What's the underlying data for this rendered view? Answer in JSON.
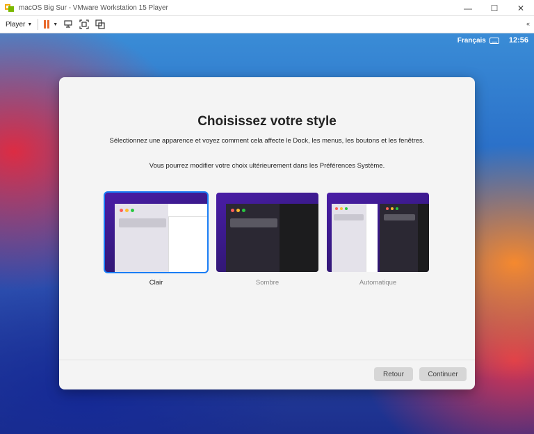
{
  "window": {
    "title": "macOS Big Sur - VMware Workstation 15 Player",
    "minimize": "—",
    "maximize": "☐",
    "close": "✕"
  },
  "toolbar": {
    "player_label": "Player",
    "collapse": "«"
  },
  "menubar": {
    "language": "Français",
    "clock": "12:56"
  },
  "dialog": {
    "title": "Choisissez votre style",
    "description": "Sélectionnez une apparence et voyez comment cela affecte le Dock, les menus, les boutons et les fenêtres.",
    "note": "Vous pourrez modifier votre choix ultérieurement dans les Préférences Système.",
    "options": [
      {
        "label": "Clair",
        "selected": true
      },
      {
        "label": "Sombre",
        "selected": false
      },
      {
        "label": "Automatique",
        "selected": false
      }
    ],
    "back_button": "Retour",
    "continue_button": "Continuer"
  },
  "colors": {
    "selection_accent": "#1a7df5",
    "pause_icon": "#e8682a"
  }
}
